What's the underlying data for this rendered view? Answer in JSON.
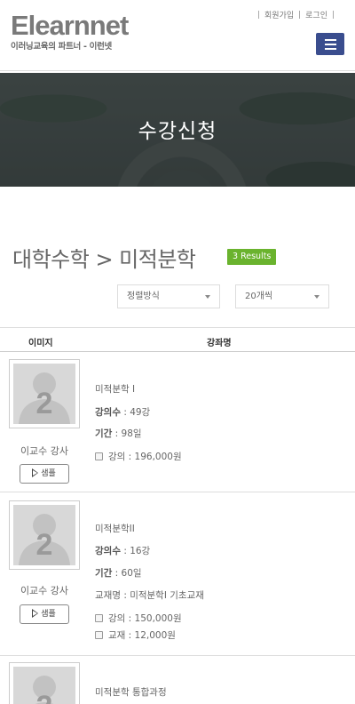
{
  "brand": {
    "name": "Elearnnet",
    "tagline": "이러닝교육의 파트너 - 이런넷"
  },
  "top_links": {
    "join": "회원가입",
    "login": "로그인"
  },
  "banner": {
    "title": "수강신청"
  },
  "breadcrumb": {
    "path": "대학수학 > 미적분학",
    "results": "3 Results"
  },
  "filters": {
    "sort": "정렬방식",
    "count": "20개씩"
  },
  "table": {
    "col_image": "이미지",
    "col_name": "강좌명"
  },
  "courses": [
    {
      "thumb_number": "2",
      "teacher": "이교수 강사",
      "sample": "샘플",
      "title": "미적분학 I",
      "lessons_label": "강의수",
      "lessons": " : 49강",
      "period_label": "기간",
      "period": " : 98일",
      "textbook": "",
      "price_lecture": "강의 : 196,000원",
      "price_book": ""
    },
    {
      "thumb_number": "2",
      "teacher": "이교수 강사",
      "sample": "샘플",
      "title": "미적분학II",
      "lessons_label": "강의수",
      "lessons": " : 16강",
      "period_label": "기간",
      "period": " : 60일",
      "textbook": "교재명 : 미적분학I 기초교재",
      "price_lecture": "강의 : 150,000원",
      "price_book": "교재 : 12,000원"
    },
    {
      "thumb_number": "2",
      "title": "미적분학 통합과정"
    }
  ],
  "colors": {
    "accent": "#3a4d8e",
    "badge": "#6ab32e"
  }
}
